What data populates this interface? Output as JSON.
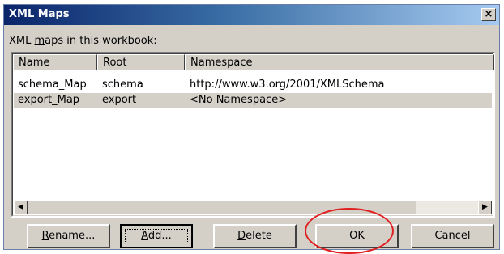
{
  "window": {
    "title": "XML Maps",
    "close_glyph": "×"
  },
  "label": {
    "prefix": "XML ",
    "accel": "m",
    "suffix": "aps in this workbook:"
  },
  "table": {
    "columns": [
      "Name",
      "Root",
      "Namespace"
    ],
    "rows": [
      {
        "name": "schema_Map",
        "root": "schema",
        "namespace": "http://www.w3.org/2001/XMLSchema",
        "selected": false
      },
      {
        "name": "export_Map",
        "root": "export",
        "namespace": "<No Namespace>",
        "selected": true
      }
    ]
  },
  "scrollbar": {
    "left_glyph": "◀",
    "right_glyph": "▶"
  },
  "buttons": {
    "rename": {
      "accel": "R",
      "rest": "ename..."
    },
    "add": {
      "accel": "A",
      "rest": "dd..."
    },
    "delete": {
      "accel": "D",
      "rest": "elete"
    },
    "ok": {
      "label": "OK"
    },
    "cancel": {
      "label": "Cancel"
    }
  },
  "colors": {
    "title_gradient_start": "#0a246a",
    "highlight": "#e02020",
    "face": "#d4d0c8"
  }
}
